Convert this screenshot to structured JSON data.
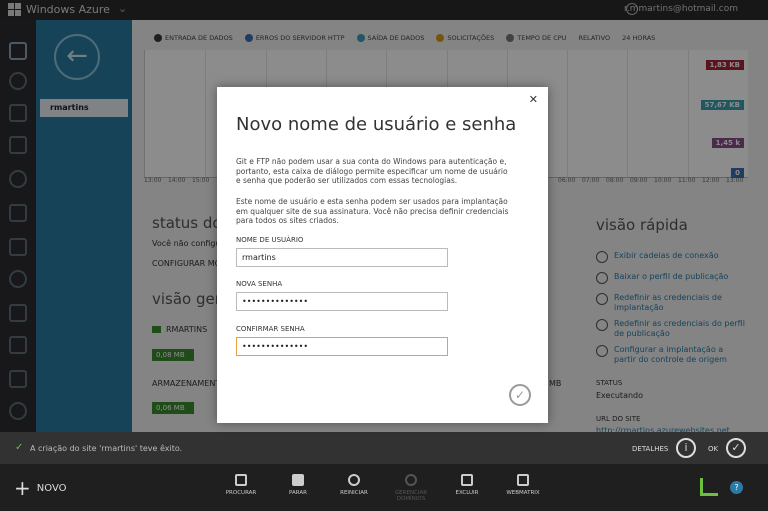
{
  "topbar": {
    "brand": "Windows Azure",
    "user_email": "r.mmartins@hotmail.com"
  },
  "sidepanel": {
    "site_name": "rmartins"
  },
  "legend": [
    {
      "label": "ENTRADA DE DADOS",
      "color": "#3a3a3a"
    },
    {
      "label": "ERROS DO SERVIDOR HTTP",
      "color": "#3a6fb0"
    },
    {
      "label": "SAÍDA DE DADOS",
      "color": "#3aa0b0"
    },
    {
      "label": "SOLICITAÇÕES",
      "color": "#d89a1a"
    },
    {
      "label": "TEMPO DE CPU",
      "color": "#777777"
    }
  ],
  "chart_controls": {
    "mode": "RELATIVO",
    "range": "24 HORAS"
  },
  "chart_values": [
    "1,83 KB",
    "57,67 KB",
    "1,45 k",
    "0"
  ],
  "time_ticks": [
    "13:00",
    "14:00",
    "15:00",
    "06:00",
    "07:00",
    "08:00",
    "09:00",
    "10:00",
    "11:00",
    "12:00",
    "13:00"
  ],
  "status_section": {
    "title": "status do po",
    "text": "Você não configu",
    "link": "CONFIGURAR MOI"
  },
  "overview": {
    "title": "visão geral d",
    "legend_label": "RMARTINS",
    "bar1": "0,08 MB",
    "storage_label": "ARMAZENAMENT",
    "bar2": "0,06 MB",
    "right_value": "MB"
  },
  "quick": {
    "title": "visão rápida",
    "links": [
      "Exibir cadeias de conexão",
      "Baixar o perfil de publicação",
      "Redefinir as credenciais de implantação",
      "Redefinir as credenciais do perfil de publicação",
      "Configurar a implantação a partir do controle de origem"
    ],
    "status_label": "STATUS",
    "status_value": "Executando",
    "url_label": "URL DO SITE",
    "url_value": "http://rmartins.azurewebsites.net"
  },
  "message": {
    "text": "A criação do site 'rmartins' teve êxito.",
    "details": "DETALHES",
    "ok": "OK"
  },
  "commands": {
    "new": "NOVO",
    "items": [
      "PROCURAR",
      "PARAR",
      "REINICIAR",
      "GERENCIAR DOMÍNIOS",
      "EXCLUIR",
      "WEBMATRIX"
    ]
  },
  "dialog": {
    "title": "Novo nome de usuário e senha",
    "p1": "Git e FTP não podem usar a sua conta do Windows para autenticação e, portanto, esta caixa de diálogo permite especificar um nome de usuário e senha que poderão ser utilizados com essas tecnologias.",
    "p2": "Este nome de usuário e esta senha podem ser usados para implantação em qualquer site de sua assinatura. Você não precisa definir credenciais para todos os sites criados.",
    "username_label": "NOME DE USUÁRIO",
    "username_value": "rmartins",
    "password_label": "NOVA SENHA",
    "password_value": "••••••••••••••",
    "confirm_label": "CONFIRMAR SENHA",
    "confirm_value": "••••••••••••••"
  }
}
